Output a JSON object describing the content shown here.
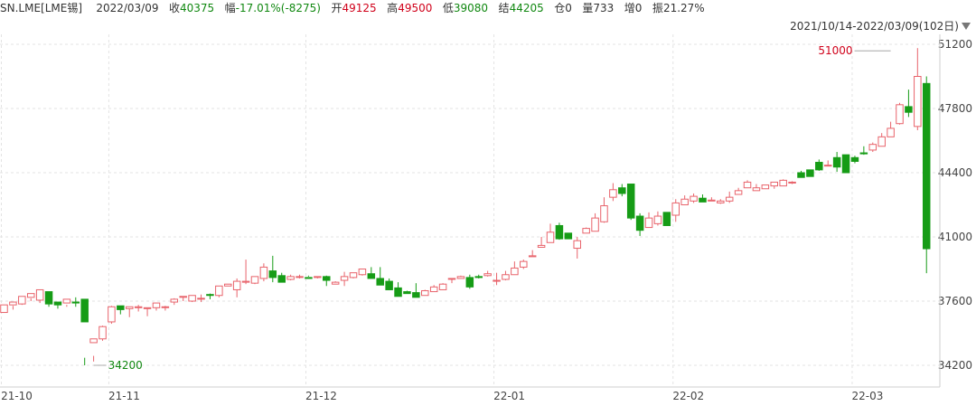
{
  "header": {
    "symbol": "SN.LME[LME锡]",
    "date": "2022/03/09",
    "close_label": "收",
    "close_value": "40375",
    "change_label": "幅",
    "change_value": "-17.01%(-8275)",
    "open_label": "开",
    "open_value": "49125",
    "high_label": "高",
    "high_value": "49500",
    "low_label": "低",
    "low_value": "39080",
    "settle_label": "结",
    "settle_value": "44205",
    "oi_label": "仓",
    "oi_value": "0",
    "volume_label": "量",
    "volume_value": "733",
    "increase_label": "增",
    "increase_value": "0",
    "amplitude_label": "振",
    "amplitude_value": "21.27%"
  },
  "range_selector": {
    "label": "2021/10/14-2022/03/09(102日)",
    "icon": "triangle-down-icon"
  },
  "colors": {
    "up": "#e8636b",
    "down": "#169c16",
    "grid": "#e3e3e3",
    "axis_text": "#444444",
    "max_label": "#d0021b",
    "min_label": "#118811"
  },
  "chart_data": {
    "type": "candlestick",
    "title": "",
    "xlabel": "",
    "ylabel": "",
    "ylim": [
      33400,
      51600
    ],
    "y_ticks": [
      34200,
      37600,
      41000,
      44400,
      47800,
      51200
    ],
    "x_ticks": [
      "21-10",
      "21-11",
      "21-12",
      "22-01",
      "22-02",
      "22-03"
    ],
    "x_tick_index": [
      0,
      12,
      34,
      55,
      75,
      95
    ],
    "grid": true,
    "annotations": [
      {
        "text": "51000",
        "index": 99,
        "value": 51000,
        "kind": "max"
      },
      {
        "text": "34200",
        "index": 10,
        "value": 34200,
        "kind": "min"
      }
    ],
    "candles": [
      [
        37000,
        37400,
        36600,
        36600
      ],
      [
        37400,
        37550,
        37150,
        37350
      ],
      [
        37450,
        37850,
        37400,
        37800
      ],
      [
        37800,
        38000,
        37600,
        37750
      ],
      [
        37650,
        38200,
        37500,
        38150
      ],
      [
        38100,
        37450,
        37300,
        37450
      ],
      [
        37550,
        37400,
        37200,
        37450
      ],
      [
        37500,
        37700,
        37400,
        37300
      ],
      [
        37550,
        37500,
        37300,
        37800
      ],
      [
        37700,
        36500,
        34200,
        34600
      ],
      [
        35400,
        35600,
        34400,
        34700
      ],
      [
        35600,
        36250,
        35500,
        36300
      ],
      [
        36500,
        37300,
        36400,
        37350
      ],
      [
        37350,
        37150,
        36900,
        37200
      ],
      [
        37200,
        37300,
        36750,
        37250
      ],
      [
        37250,
        37300,
        37050,
        37400
      ],
      [
        37200,
        37250,
        36800,
        37200
      ],
      [
        37250,
        37500,
        37100,
        37500
      ],
      [
        37300,
        37300,
        37100,
        37350
      ],
      [
        37550,
        37700,
        37400,
        37750
      ],
      [
        37800,
        37850,
        37600,
        37800
      ],
      [
        37600,
        37900,
        37550,
        37900
      ],
      [
        37750,
        37750,
        37550,
        37950
      ],
      [
        37950,
        37900,
        37700,
        38000
      ],
      [
        37900,
        38400,
        37800,
        38300
      ],
      [
        38400,
        38500,
        38300,
        38300
      ],
      [
        38200,
        38650,
        37800,
        38800
      ],
      [
        38600,
        38650,
        38500,
        39800
      ],
      [
        38550,
        38900,
        38500,
        38800
      ],
      [
        38800,
        39400,
        38650,
        39600
      ],
      [
        39200,
        38850,
        38600,
        40000
      ],
      [
        38950,
        38600,
        38800,
        39100
      ],
      [
        38750,
        38900,
        38700,
        39000
      ],
      [
        38900,
        38900,
        38800,
        39000
      ],
      [
        38850,
        38800,
        38950,
        38900
      ],
      [
        38850,
        38900,
        38800,
        38900
      ],
      [
        38900,
        38700,
        38400,
        38950
      ],
      [
        38500,
        38600,
        38500,
        38650
      ],
      [
        38700,
        38900,
        38400,
        39150
      ],
      [
        38850,
        39100,
        38800,
        39100
      ],
      [
        39000,
        39300,
        38950,
        39150
      ],
      [
        39050,
        38800,
        38850,
        39400
      ],
      [
        38800,
        38450,
        38600,
        39400
      ],
      [
        38650,
        38200,
        38350,
        38800
      ],
      [
        38300,
        37850,
        37900,
        38600
      ],
      [
        38100,
        38000,
        38000,
        38150
      ],
      [
        38050,
        37800,
        37900,
        38550
      ],
      [
        37900,
        38150,
        37950,
        38200
      ],
      [
        38100,
        38350,
        38100,
        38450
      ],
      [
        38200,
        38500,
        38300,
        38550
      ],
      [
        38800,
        38800,
        38550,
        38750
      ],
      [
        38800,
        38900,
        38800,
        38950
      ],
      [
        38850,
        38350,
        38250,
        39000
      ],
      [
        38900,
        38850,
        38800,
        39000
      ],
      [
        38950,
        39050,
        38900,
        39200
      ],
      [
        38700,
        38700,
        38450,
        39100
      ],
      [
        38750,
        39000,
        38700,
        39200
      ],
      [
        39000,
        39350,
        39000,
        39700
      ],
      [
        39400,
        39700,
        39300,
        39800
      ],
      [
        39950,
        40000,
        39950,
        40300
      ],
      [
        40450,
        40550,
        40450,
        41000
      ],
      [
        40700,
        41250,
        41200,
        41700
      ],
      [
        41600,
        40900,
        40850,
        41750
      ],
      [
        41200,
        40900,
        40900,
        41200
      ],
      [
        40400,
        40800,
        39850,
        41000
      ],
      [
        41200,
        41450,
        41350,
        41500
      ],
      [
        41300,
        42000,
        41450,
        42250
      ],
      [
        41800,
        42650,
        41750,
        43100
      ],
      [
        43100,
        43500,
        42900,
        43850
      ],
      [
        43600,
        43300,
        43150,
        43800
      ],
      [
        43800,
        42000,
        41900,
        43700
      ],
      [
        42100,
        41350,
        41050,
        42250
      ],
      [
        41500,
        42000,
        41550,
        42300
      ],
      [
        41700,
        42100,
        41600,
        42350
      ],
      [
        42300,
        41600,
        41850,
        42250
      ],
      [
        42150,
        42800,
        41800,
        43000
      ],
      [
        42700,
        43000,
        42700,
        43200
      ],
      [
        42900,
        43150,
        42800,
        43300
      ],
      [
        43050,
        42850,
        42950,
        43250
      ],
      [
        42900,
        42950,
        42900,
        43100
      ],
      [
        42800,
        42900,
        42750,
        43000
      ],
      [
        42900,
        43100,
        42800,
        43400
      ],
      [
        43250,
        43450,
        43250,
        43600
      ],
      [
        43600,
        43900,
        43600,
        44000
      ],
      [
        43450,
        43600,
        43550,
        43800
      ],
      [
        43550,
        43750,
        43600,
        43700
      ],
      [
        43700,
        43900,
        43550,
        43800
      ],
      [
        43700,
        44000,
        43700,
        44050
      ],
      [
        43900,
        43900,
        43800,
        43950
      ],
      [
        44400,
        44150,
        44300,
        44500
      ],
      [
        44550,
        44200,
        44250,
        44400
      ],
      [
        44950,
        44550,
        44500,
        45100
      ],
      [
        44800,
        44800,
        44750,
        45050
      ],
      [
        45200,
        44700,
        44450,
        45500
      ],
      [
        45350,
        44400,
        44500,
        45300
      ],
      [
        45200,
        45000,
        44900,
        45300
      ],
      [
        45450,
        45400,
        45350,
        45800
      ],
      [
        45600,
        45900,
        45500,
        46000
      ],
      [
        45800,
        46300,
        45850,
        46500
      ],
      [
        46300,
        46750,
        46300,
        47100
      ],
      [
        47000,
        48000,
        46950,
        48100
      ],
      [
        47900,
        47600,
        47350,
        48800
      ],
      [
        46850,
        49500,
        46650,
        51000
      ],
      [
        49125,
        40375,
        39080,
        49500
      ]
    ]
  }
}
